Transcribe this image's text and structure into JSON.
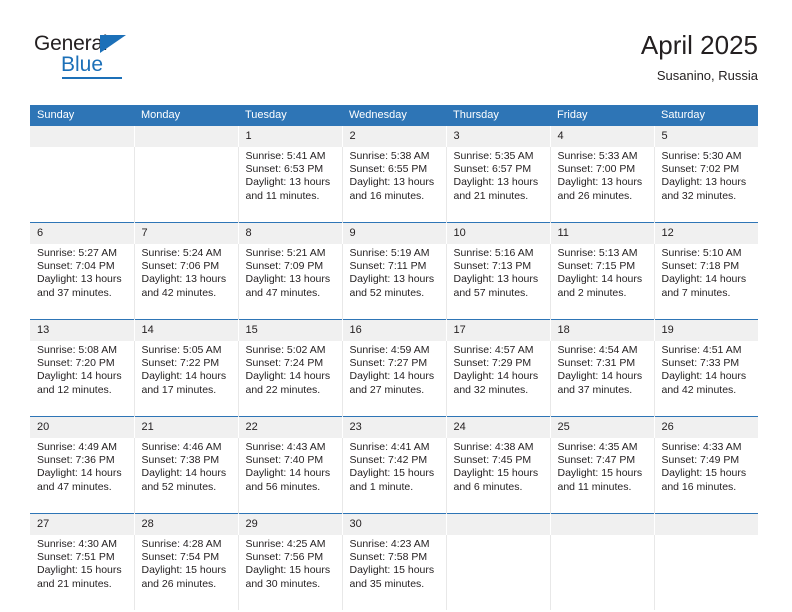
{
  "brand": {
    "name_part1": "General",
    "name_part2": "Blue",
    "flag_color": "#1c70b8"
  },
  "header": {
    "title": "April 2025",
    "subtitle": "Susanino, Russia",
    "accent_color": "#2e75b6"
  },
  "calendar": {
    "weekday_headers": [
      "Sunday",
      "Monday",
      "Tuesday",
      "Wednesday",
      "Thursday",
      "Friday",
      "Saturday"
    ],
    "weeks": [
      {
        "numbers": [
          "",
          "",
          "1",
          "2",
          "3",
          "4",
          "5"
        ],
        "cells": [
          {
            "day": "",
            "sunrise": "",
            "sunset": "",
            "daylight1": "",
            "daylight2": ""
          },
          {
            "day": "",
            "sunrise": "",
            "sunset": "",
            "daylight1": "",
            "daylight2": ""
          },
          {
            "day": "1",
            "sunrise": "Sunrise: 5:41 AM",
            "sunset": "Sunset: 6:53 PM",
            "daylight1": "Daylight: 13 hours",
            "daylight2": "and 11 minutes."
          },
          {
            "day": "2",
            "sunrise": "Sunrise: 5:38 AM",
            "sunset": "Sunset: 6:55 PM",
            "daylight1": "Daylight: 13 hours",
            "daylight2": "and 16 minutes."
          },
          {
            "day": "3",
            "sunrise": "Sunrise: 5:35 AM",
            "sunset": "Sunset: 6:57 PM",
            "daylight1": "Daylight: 13 hours",
            "daylight2": "and 21 minutes."
          },
          {
            "day": "4",
            "sunrise": "Sunrise: 5:33 AM",
            "sunset": "Sunset: 7:00 PM",
            "daylight1": "Daylight: 13 hours",
            "daylight2": "and 26 minutes."
          },
          {
            "day": "5",
            "sunrise": "Sunrise: 5:30 AM",
            "sunset": "Sunset: 7:02 PM",
            "daylight1": "Daylight: 13 hours",
            "daylight2": "and 32 minutes."
          }
        ]
      },
      {
        "numbers": [
          "6",
          "7",
          "8",
          "9",
          "10",
          "11",
          "12"
        ],
        "cells": [
          {
            "day": "6",
            "sunrise": "Sunrise: 5:27 AM",
            "sunset": "Sunset: 7:04 PM",
            "daylight1": "Daylight: 13 hours",
            "daylight2": "and 37 minutes."
          },
          {
            "day": "7",
            "sunrise": "Sunrise: 5:24 AM",
            "sunset": "Sunset: 7:06 PM",
            "daylight1": "Daylight: 13 hours",
            "daylight2": "and 42 minutes."
          },
          {
            "day": "8",
            "sunrise": "Sunrise: 5:21 AM",
            "sunset": "Sunset: 7:09 PM",
            "daylight1": "Daylight: 13 hours",
            "daylight2": "and 47 minutes."
          },
          {
            "day": "9",
            "sunrise": "Sunrise: 5:19 AM",
            "sunset": "Sunset: 7:11 PM",
            "daylight1": "Daylight: 13 hours",
            "daylight2": "and 52 minutes."
          },
          {
            "day": "10",
            "sunrise": "Sunrise: 5:16 AM",
            "sunset": "Sunset: 7:13 PM",
            "daylight1": "Daylight: 13 hours",
            "daylight2": "and 57 minutes."
          },
          {
            "day": "11",
            "sunrise": "Sunrise: 5:13 AM",
            "sunset": "Sunset: 7:15 PM",
            "daylight1": "Daylight: 14 hours",
            "daylight2": "and 2 minutes."
          },
          {
            "day": "12",
            "sunrise": "Sunrise: 5:10 AM",
            "sunset": "Sunset: 7:18 PM",
            "daylight1": "Daylight: 14 hours",
            "daylight2": "and 7 minutes."
          }
        ]
      },
      {
        "numbers": [
          "13",
          "14",
          "15",
          "16",
          "17",
          "18",
          "19"
        ],
        "cells": [
          {
            "day": "13",
            "sunrise": "Sunrise: 5:08 AM",
            "sunset": "Sunset: 7:20 PM",
            "daylight1": "Daylight: 14 hours",
            "daylight2": "and 12 minutes."
          },
          {
            "day": "14",
            "sunrise": "Sunrise: 5:05 AM",
            "sunset": "Sunset: 7:22 PM",
            "daylight1": "Daylight: 14 hours",
            "daylight2": "and 17 minutes."
          },
          {
            "day": "15",
            "sunrise": "Sunrise: 5:02 AM",
            "sunset": "Sunset: 7:24 PM",
            "daylight1": "Daylight: 14 hours",
            "daylight2": "and 22 minutes."
          },
          {
            "day": "16",
            "sunrise": "Sunrise: 4:59 AM",
            "sunset": "Sunset: 7:27 PM",
            "daylight1": "Daylight: 14 hours",
            "daylight2": "and 27 minutes."
          },
          {
            "day": "17",
            "sunrise": "Sunrise: 4:57 AM",
            "sunset": "Sunset: 7:29 PM",
            "daylight1": "Daylight: 14 hours",
            "daylight2": "and 32 minutes."
          },
          {
            "day": "18",
            "sunrise": "Sunrise: 4:54 AM",
            "sunset": "Sunset: 7:31 PM",
            "daylight1": "Daylight: 14 hours",
            "daylight2": "and 37 minutes."
          },
          {
            "day": "19",
            "sunrise": "Sunrise: 4:51 AM",
            "sunset": "Sunset: 7:33 PM",
            "daylight1": "Daylight: 14 hours",
            "daylight2": "and 42 minutes."
          }
        ]
      },
      {
        "numbers": [
          "20",
          "21",
          "22",
          "23",
          "24",
          "25",
          "26"
        ],
        "cells": [
          {
            "day": "20",
            "sunrise": "Sunrise: 4:49 AM",
            "sunset": "Sunset: 7:36 PM",
            "daylight1": "Daylight: 14 hours",
            "daylight2": "and 47 minutes."
          },
          {
            "day": "21",
            "sunrise": "Sunrise: 4:46 AM",
            "sunset": "Sunset: 7:38 PM",
            "daylight1": "Daylight: 14 hours",
            "daylight2": "and 52 minutes."
          },
          {
            "day": "22",
            "sunrise": "Sunrise: 4:43 AM",
            "sunset": "Sunset: 7:40 PM",
            "daylight1": "Daylight: 14 hours",
            "daylight2": "and 56 minutes."
          },
          {
            "day": "23",
            "sunrise": "Sunrise: 4:41 AM",
            "sunset": "Sunset: 7:42 PM",
            "daylight1": "Daylight: 15 hours",
            "daylight2": "and 1 minute."
          },
          {
            "day": "24",
            "sunrise": "Sunrise: 4:38 AM",
            "sunset": "Sunset: 7:45 PM",
            "daylight1": "Daylight: 15 hours",
            "daylight2": "and 6 minutes."
          },
          {
            "day": "25",
            "sunrise": "Sunrise: 4:35 AM",
            "sunset": "Sunset: 7:47 PM",
            "daylight1": "Daylight: 15 hours",
            "daylight2": "and 11 minutes."
          },
          {
            "day": "26",
            "sunrise": "Sunrise: 4:33 AM",
            "sunset": "Sunset: 7:49 PM",
            "daylight1": "Daylight: 15 hours",
            "daylight2": "and 16 minutes."
          }
        ]
      },
      {
        "numbers": [
          "27",
          "28",
          "29",
          "30",
          "",
          "",
          ""
        ],
        "cells": [
          {
            "day": "27",
            "sunrise": "Sunrise: 4:30 AM",
            "sunset": "Sunset: 7:51 PM",
            "daylight1": "Daylight: 15 hours",
            "daylight2": "and 21 minutes."
          },
          {
            "day": "28",
            "sunrise": "Sunrise: 4:28 AM",
            "sunset": "Sunset: 7:54 PM",
            "daylight1": "Daylight: 15 hours",
            "daylight2": "and 26 minutes."
          },
          {
            "day": "29",
            "sunrise": "Sunrise: 4:25 AM",
            "sunset": "Sunset: 7:56 PM",
            "daylight1": "Daylight: 15 hours",
            "daylight2": "and 30 minutes."
          },
          {
            "day": "30",
            "sunrise": "Sunrise: 4:23 AM",
            "sunset": "Sunset: 7:58 PM",
            "daylight1": "Daylight: 15 hours",
            "daylight2": "and 35 minutes."
          },
          {
            "day": "",
            "sunrise": "",
            "sunset": "",
            "daylight1": "",
            "daylight2": ""
          },
          {
            "day": "",
            "sunrise": "",
            "sunset": "",
            "daylight1": "",
            "daylight2": ""
          },
          {
            "day": "",
            "sunrise": "",
            "sunset": "",
            "daylight1": "",
            "daylight2": ""
          }
        ]
      }
    ]
  }
}
